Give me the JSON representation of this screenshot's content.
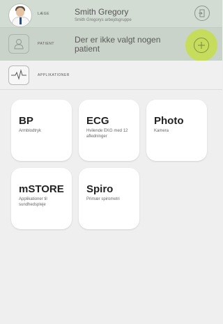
{
  "doctor": {
    "label": "LÆGE",
    "name": "Smith Gregory",
    "group": "Smith Gregorys arbejdsgruppe"
  },
  "patient": {
    "label": "PATIENT",
    "status_text": "Der er ikke valgt nogen patient"
  },
  "apps": {
    "label": "APPLIKATIONER",
    "tiles": [
      {
        "title": "BP",
        "subtitle": "Armblodtryk"
      },
      {
        "title": "ECG",
        "subtitle": "Hvilende EKG med 12 afledninger"
      },
      {
        "title": "Photo",
        "subtitle": "Kamera"
      },
      {
        "title": "mSTORE",
        "subtitle": "Applikationer til sundhedspleje"
      },
      {
        "title": "Spiro",
        "subtitle": "Primær spirometri"
      }
    ]
  },
  "colors": {
    "header_bg": "#d3dcd3",
    "patient_bg": "#c9d3c9",
    "accent": "#c6dd57",
    "background": "#efefef"
  },
  "icons": {
    "avatar": "doctor-avatar",
    "logout": "logout-door-icon",
    "patient": "person-icon",
    "add": "plus-icon",
    "apps": "pulse-icon"
  }
}
